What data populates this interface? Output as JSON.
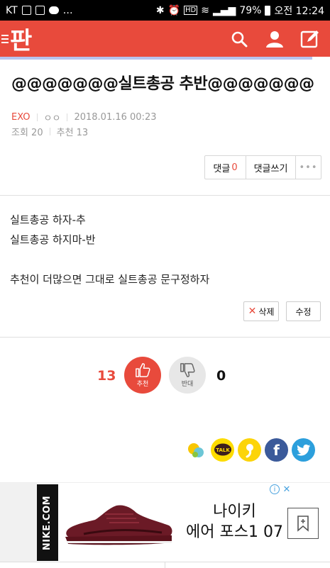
{
  "status_bar": {
    "carrier": "KT",
    "battery": "79%",
    "time": "오전 12:24"
  },
  "header": {
    "logo": "판",
    "actions": [
      "search-icon",
      "user-icon",
      "write-icon"
    ]
  },
  "post": {
    "title": "@@@@@@@실트총공 추반@@@@@@@",
    "category": "EXO",
    "author": "ㅇㅇ",
    "datetime": "2018.01.16 00:23",
    "views": "조회 20",
    "recommends": "추천 13",
    "comment_label": "댓글",
    "comment_count": "0",
    "write_comment_label": "댓글쓰기",
    "more_label": "•••",
    "body_lines": [
      "실트총공 하자-추",
      "실트총공 하지마-반",
      "추천이 더많으면 그대로 실트총공 문구정하자"
    ],
    "delete_label": "삭제",
    "edit_label": "수정"
  },
  "votes": {
    "up_count": "13",
    "up_label": "추천",
    "down_label": "반대",
    "down_count": "0"
  },
  "share": [
    "kakaostory-icon",
    "kakaotalk-icon",
    "quote-icon",
    "facebook-icon",
    "twitter-icon"
  ],
  "share_talk_label": "TALK",
  "ad": {
    "brand": "NIKE.COM",
    "line1": "나이키",
    "line2": "에어 포스1 07"
  },
  "colors": {
    "accent": "#e84a3c",
    "facebook": "#3b5a9a",
    "twitter": "#2c9fdc",
    "kakao": "#fddc00"
  }
}
